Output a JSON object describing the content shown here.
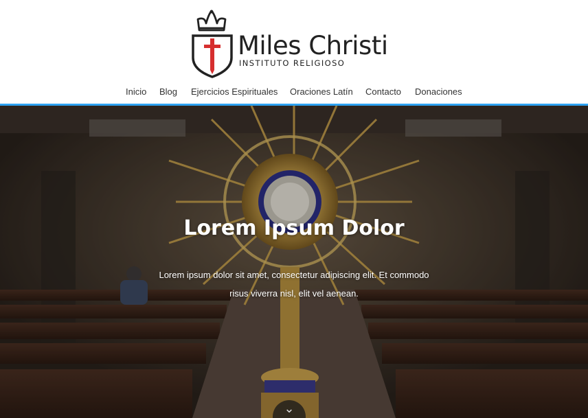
{
  "site": {
    "name": "Miles Christi",
    "tagline": "INSTITUTO RELIGIOSO"
  },
  "nav": {
    "items": [
      {
        "label": "Inicio"
      },
      {
        "label": "Blog"
      },
      {
        "label": "Ejercicios Espirituales"
      },
      {
        "label": "Oraciones Latín"
      },
      {
        "label": "Contacto"
      },
      {
        "label": "Donaciones"
      }
    ]
  },
  "hero": {
    "title": "Lorem Ipsum Dolor",
    "text": "Lorem ipsum dolor sit amet, consectetur adipiscing elit. Et commodo risus viverra nisl, elit vel aenean.",
    "background_image": "monstrance-in-church",
    "scroll_icon": "chevron-down-icon"
  },
  "colors": {
    "accent": "#2ea3f2",
    "logo_cross": "#d62f2f",
    "text_dark": "#222222"
  }
}
